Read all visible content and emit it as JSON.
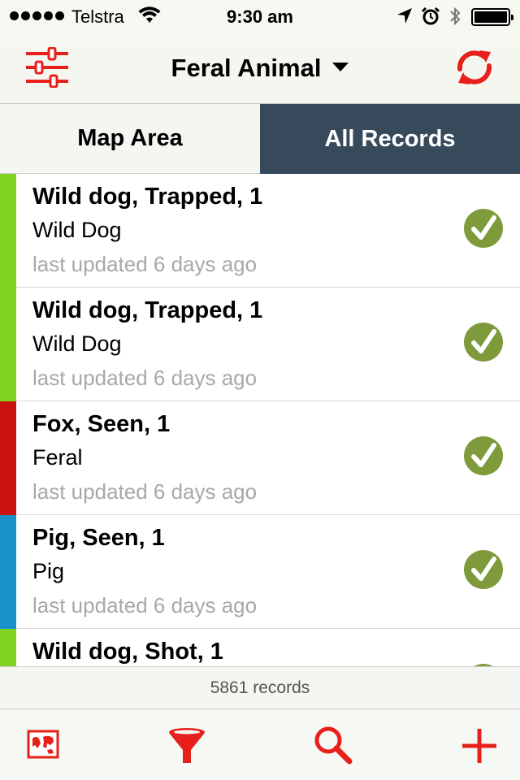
{
  "status_bar": {
    "carrier": "Telstra",
    "time": "9:30 am"
  },
  "nav": {
    "title": "Feral Animal",
    "left_icon": "sliders-icon",
    "right_icon": "refresh-icon",
    "accent_color": "#e8201c"
  },
  "segments": {
    "map_area": "Map Area",
    "all_records": "All Records",
    "active": "all_records",
    "active_color": "#364a5c"
  },
  "records": [
    {
      "title": "Wild dog, Trapped, 1",
      "subtitle": "Wild Dog",
      "updated": "last updated 6 days ago",
      "color": "#7ed321"
    },
    {
      "title": "Wild dog, Trapped, 1",
      "subtitle": "Wild Dog",
      "updated": "last updated 6 days ago",
      "color": "#7ed321"
    },
    {
      "title": "Fox, Seen, 1",
      "subtitle": "Feral",
      "updated": "last updated 6 days ago",
      "color": "#cc1111"
    },
    {
      "title": "Pig, Seen, 1",
      "subtitle": "Pig",
      "updated": "last updated 6 days ago",
      "color": "#1a90c8"
    },
    {
      "title": "Wild dog, Shot, 1",
      "subtitle": "",
      "updated": "",
      "color": "#7ed321"
    }
  ],
  "check_color": "#7e9a3a",
  "footer": {
    "count": "5861 records"
  },
  "tabbar": {
    "icons": [
      "map-icon",
      "filter-icon",
      "search-icon",
      "add-icon"
    ]
  }
}
